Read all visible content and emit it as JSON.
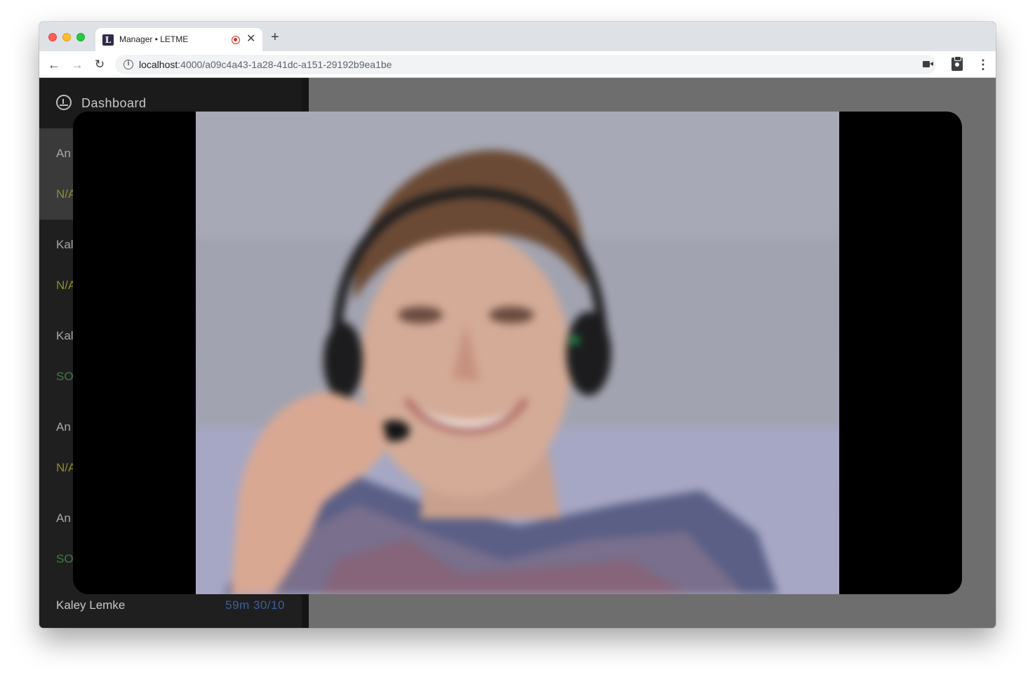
{
  "browser": {
    "tab_title": "Manager • LETME",
    "favicon_letter": "L",
    "url_host": "localhost",
    "url_path": ":4000/a09c4a43-1a28-41dc-a151-29192b9ea1be"
  },
  "sidebar": {
    "dashboard_label": "Dashboard",
    "agents": [
      {
        "name": "An",
        "status": "N/A",
        "status_color": "#8c8a2e"
      },
      {
        "name": "Kal",
        "status": "N/A",
        "status_color": "#8c8a2e"
      },
      {
        "name": "Kal",
        "status": "SO",
        "status_color": "#3f7d44"
      },
      {
        "name": "An",
        "status": "N/A",
        "status_color": "#8c8a2e"
      },
      {
        "name": "An",
        "status": "SO",
        "status_color": "#3f7d44"
      }
    ],
    "last_agent": {
      "name": "Kaley Lemke",
      "meta": "59m 30/10"
    }
  },
  "modal": {
    "type": "video-feed",
    "subject": "person wearing headset"
  }
}
